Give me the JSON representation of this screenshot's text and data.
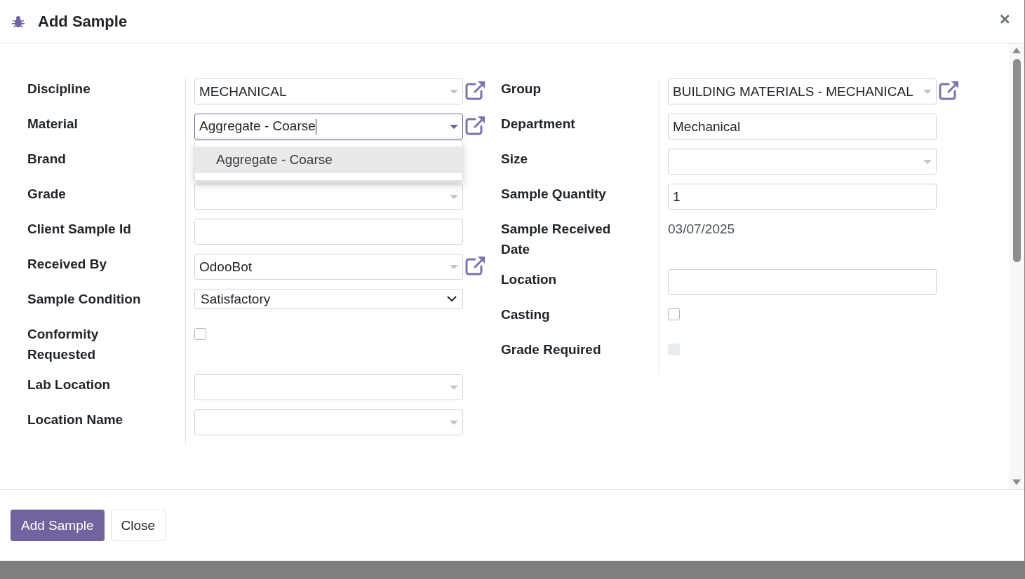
{
  "dialog": {
    "title": "Add Sample",
    "close": "×"
  },
  "left_fields": [
    {
      "label": "Discipline",
      "kind": "many2one",
      "value": "MECHANICAL",
      "link": true,
      "focused": false
    },
    {
      "label": "Material",
      "kind": "many2one",
      "value": "Aggregate - Coarse",
      "link": true,
      "focused": true,
      "dropdown": [
        {
          "label": "Aggregate - Coarse",
          "selected": true
        }
      ]
    },
    {
      "label": "Brand",
      "kind": "many2one",
      "link": false
    },
    {
      "label": "Grade",
      "kind": "many2one",
      "link": false,
      "focused": false
    },
    {
      "label": "Client Sample Id",
      "kind": "text"
    },
    {
      "label": "Received By",
      "kind": "many2one",
      "value": "OdooBot",
      "link": true,
      "focused": false
    },
    {
      "label": "Sample Condition",
      "kind": "select",
      "value": "Satisfactory"
    },
    {
      "label": "Conformity Requested",
      "kind": "checkbox",
      "checked": false,
      "disabled": false
    },
    {
      "label": "Lab Location",
      "kind": "many2one",
      "link": false,
      "focused": false
    },
    {
      "label": "Location Name",
      "kind": "many2one",
      "link": false,
      "focused": false
    }
  ],
  "right_fields": [
    {
      "label": "Group",
      "kind": "many2one",
      "value": "BUILDING MATERIALS - MECHANICAL",
      "link": true,
      "focused": false
    },
    {
      "label": "Department",
      "kind": "text",
      "value": "Mechanical"
    },
    {
      "label": "Size",
      "kind": "many2one",
      "link": false,
      "focused": false
    },
    {
      "label": "Sample Quantity",
      "kind": "text",
      "value": "1"
    },
    {
      "label": "Sample Received Date",
      "kind": "readonly",
      "value": "03/07/2025"
    },
    {
      "label": "Location",
      "kind": "text"
    },
    {
      "label": "Casting",
      "kind": "checkbox",
      "checked": false,
      "disabled": false
    },
    {
      "label": "Grade Required",
      "kind": "checkbox",
      "checked": false,
      "disabled": true
    }
  ],
  "buttons": [
    {
      "label": "Add Sample",
      "primary": true
    },
    {
      "label": "Close",
      "primary": false
    }
  ]
}
